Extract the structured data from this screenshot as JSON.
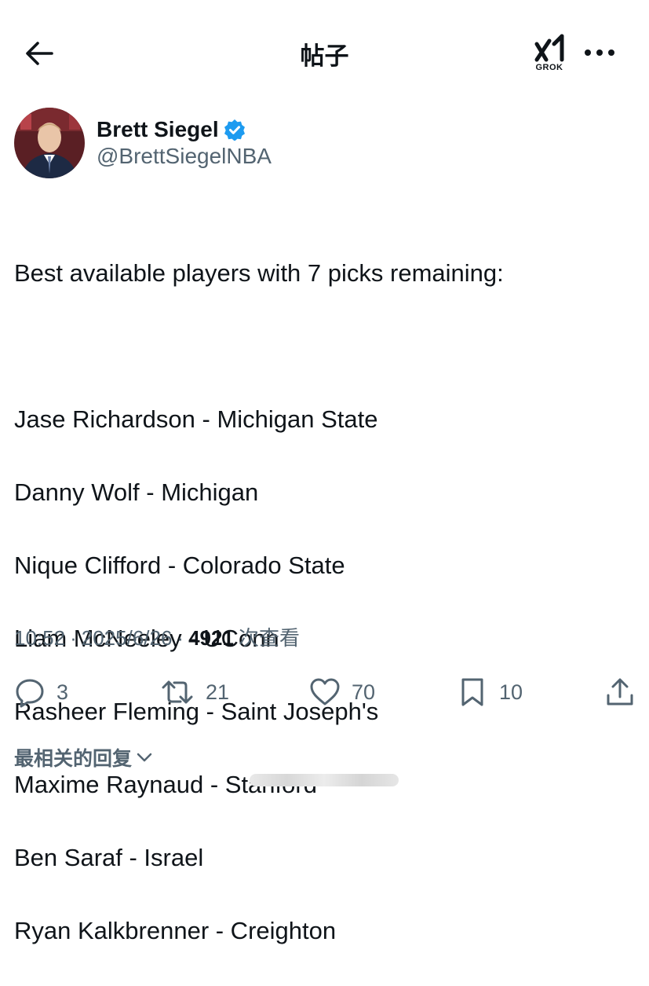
{
  "header": {
    "title": "帖子",
    "grok_label": "GROK",
    "icons": [
      "back-arrow-icon",
      "grok-icon",
      "more-icon"
    ]
  },
  "author": {
    "name": "Brett Siegel",
    "handle": "@BrettSiegelNBA",
    "verified": true,
    "verified_color": "#1d9bf0"
  },
  "post": {
    "intro": "Best available players with 7 picks remaining:",
    "players": [
      "Jase Richardson - Michigan State",
      "Danny Wolf - Michigan",
      "Nique Clifford - Colorado State",
      "Liam McNeeley - UConn",
      "Rasheer Fleming - Saint Joseph's",
      "Maxime Raynaud - Stanford",
      "Ben Saraf - Israel",
      "Ryan Kalkbrenner - Creighton"
    ]
  },
  "meta": {
    "time": "10:52",
    "separator": "·",
    "date": "2025/6/26",
    "views": "4921",
    "views_label": "次查看"
  },
  "actions": {
    "replies": "3",
    "reposts": "21",
    "likes": "70",
    "bookmarks": "10"
  },
  "replies_section": {
    "label": "最相关的回复"
  }
}
